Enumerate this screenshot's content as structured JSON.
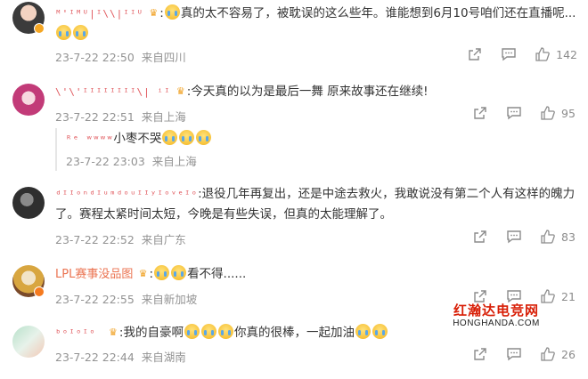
{
  "comments": [
    {
      "username": "ᴹ'ᴵᴹᵁ|ᴵ\\\\|ᴵᴵᵁ",
      "text_line1": "真的太不容易了，被耽误的这么些年。谁能想到6月10号咱们还在直播呢...",
      "time": "23-7-22 22:50",
      "location": "来自四川",
      "likes": "142"
    },
    {
      "username": "\\'\\'ᴵᴵᴵᴵᴵᴵᴵᴵ\\| ⁱᴵ",
      "text_line1": ":今天真的以为是最后一舞 原来故事还在继续!",
      "time": "23-7-22 22:51",
      "location": "来自上海",
      "likes": "95",
      "reply": {
        "username": "ᴿᵉ    ʷʷʷʷ",
        "text": "小枣不哭",
        "time": "23-7-22 23:03",
        "location": "来自上海"
      }
    },
    {
      "username": "ᵈᴵᴵᵒⁿᵈᴵᵘᵐᵈᵒᵘᴵᴵʸᴵᵒᵛᵉᴵᵒ",
      "text_line1": ":退役几年再复出，还是中途去救火，我敢说没有第二个人有这样的魄力",
      "text_line2": "了。赛程太紧时间太短，今晚是有些失误，但真的太能理解了。",
      "time": "23-7-22 22:52",
      "location": "来自广东",
      "likes": "83"
    },
    {
      "username": "LPL赛事没品图",
      "text_line1": "看不得......",
      "time": "23-7-22 22:55",
      "location": "来自新加坡",
      "likes": "21"
    },
    {
      "username": "ᵇᵒᴵᵒᴵᵒ",
      "text_pre": ":我的自豪啊",
      "text_mid": "你真的很棒，一起加油",
      "time": "23-7-22 22:44",
      "location": "来自湖南",
      "likes": "26"
    }
  ],
  "watermark": {
    "cn": "红瀚达电竞网",
    "en": "HONGHANDA.COM"
  },
  "colors": {
    "username": "#e0555a",
    "meta": "#939393",
    "badge": "#f5a623"
  }
}
